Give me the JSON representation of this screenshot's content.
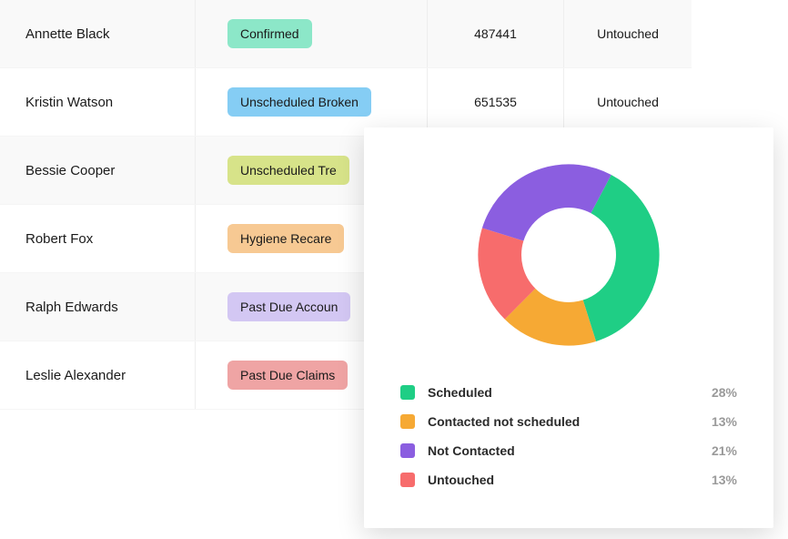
{
  "table": {
    "rows": [
      {
        "name": "Annette Black",
        "status": "Confirmed",
        "status_bg": "#8CE7C8",
        "number": "487441",
        "state": "Untouched"
      },
      {
        "name": "Kristin Watson",
        "status": "Unscheduled Broken",
        "status_bg": "#85CDF4",
        "number": "651535",
        "state": "Untouched"
      },
      {
        "name": "Bessie Cooper",
        "status": "Unscheduled Tre",
        "status_bg": "#D7E389",
        "number": "",
        "state": ""
      },
      {
        "name": "Robert Fox",
        "status": "Hygiene Recare",
        "status_bg": "#F7C993",
        "number": "",
        "state": ""
      },
      {
        "name": "Ralph Edwards",
        "status": "Past Due Accoun",
        "status_bg": "#D3C7F3",
        "number": "",
        "state": ""
      },
      {
        "name": "Leslie Alexander",
        "status": "Past Due Claims",
        "status_bg": "#EFA4A4",
        "number": "",
        "state": ""
      }
    ]
  },
  "chart_data": {
    "type": "pie",
    "series": [
      {
        "name": "Scheduled",
        "value": 28,
        "color": "#1FCE85"
      },
      {
        "name": "Contacted not scheduled",
        "value": 13,
        "color": "#F6A934"
      },
      {
        "name": "Not Contacted",
        "value": 21,
        "color": "#8B5EE0"
      },
      {
        "name": "Untouched",
        "value": 13,
        "color": "#F76C6C"
      }
    ]
  }
}
